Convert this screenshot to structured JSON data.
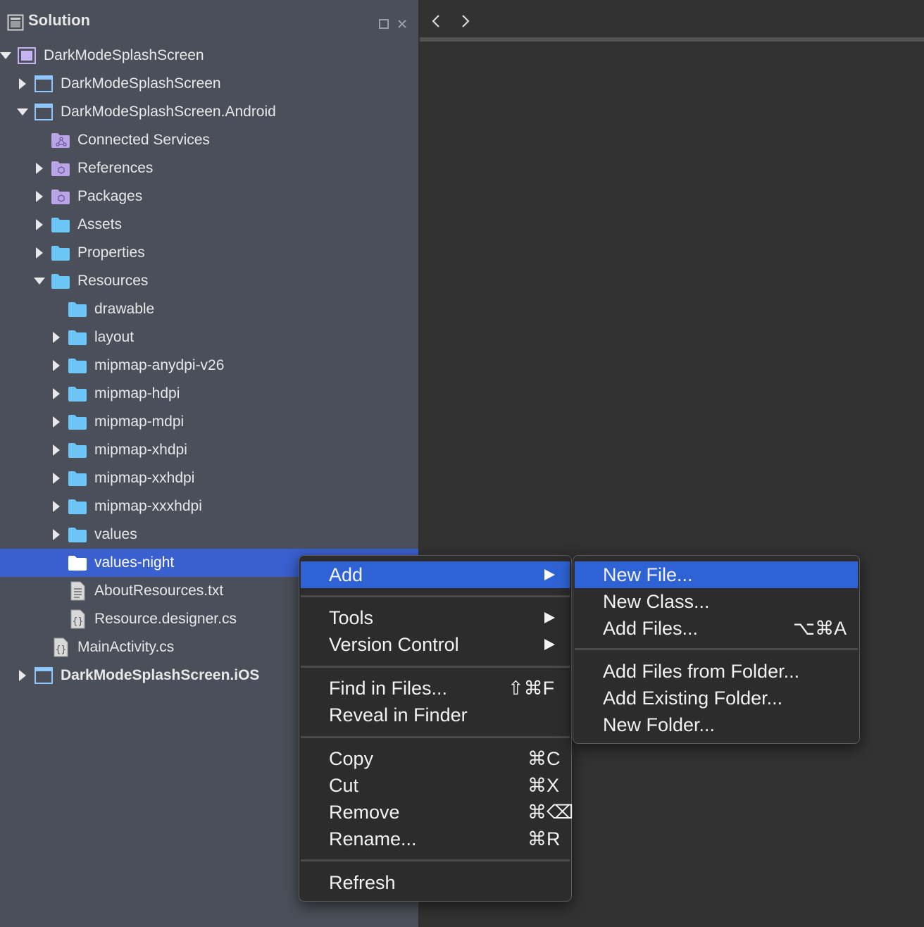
{
  "pane": {
    "title": "Solution"
  },
  "tree": [
    {
      "label": "DarkModeSplashScreen",
      "icon": "solution-icon",
      "toggle": "expanded",
      "bold": false
    },
    {
      "label": "DarkModeSplashScreen",
      "icon": "project-icon",
      "toggle": "collapsed",
      "bold": false
    },
    {
      "label": "DarkModeSplashScreen.Android",
      "icon": "project-icon",
      "toggle": "expanded",
      "bold": false
    },
    {
      "label": "Connected Services",
      "icon": "connected-services-folder-icon",
      "toggle": "none",
      "bold": false
    },
    {
      "label": "References",
      "icon": "references-folder-icon",
      "toggle": "collapsed",
      "bold": false
    },
    {
      "label": "Packages",
      "icon": "packages-folder-icon",
      "toggle": "collapsed",
      "bold": false
    },
    {
      "label": "Assets",
      "icon": "folder-icon",
      "toggle": "collapsed",
      "bold": false
    },
    {
      "label": "Properties",
      "icon": "folder-icon",
      "toggle": "collapsed",
      "bold": false
    },
    {
      "label": "Resources",
      "icon": "folder-icon",
      "toggle": "expanded",
      "bold": false
    },
    {
      "label": "drawable",
      "icon": "folder-icon",
      "toggle": "none",
      "bold": false
    },
    {
      "label": "layout",
      "icon": "folder-icon",
      "toggle": "collapsed",
      "bold": false
    },
    {
      "label": "mipmap-anydpi-v26",
      "icon": "folder-icon",
      "toggle": "collapsed",
      "bold": false
    },
    {
      "label": "mipmap-hdpi",
      "icon": "folder-icon",
      "toggle": "collapsed",
      "bold": false
    },
    {
      "label": "mipmap-mdpi",
      "icon": "folder-icon",
      "toggle": "collapsed",
      "bold": false
    },
    {
      "label": "mipmap-xhdpi",
      "icon": "folder-icon",
      "toggle": "collapsed",
      "bold": false
    },
    {
      "label": "mipmap-xxhdpi",
      "icon": "folder-icon",
      "toggle": "collapsed",
      "bold": false
    },
    {
      "label": "mipmap-xxxhdpi",
      "icon": "folder-icon",
      "toggle": "collapsed",
      "bold": false
    },
    {
      "label": "values",
      "icon": "folder-icon",
      "toggle": "collapsed",
      "bold": false
    },
    {
      "label": "values-night",
      "icon": "folder-icon",
      "toggle": "none",
      "bold": false,
      "selected": true
    },
    {
      "label": "AboutResources.txt",
      "icon": "text-file-icon",
      "toggle": "none",
      "bold": false
    },
    {
      "label": "Resource.designer.cs",
      "icon": "csharp-file-icon",
      "toggle": "none",
      "bold": false
    },
    {
      "label": "MainActivity.cs",
      "icon": "csharp-file-icon",
      "toggle": "none",
      "bold": false
    },
    {
      "label": "DarkModeSplashScreen.iOS",
      "icon": "project-icon",
      "toggle": "collapsed",
      "bold": true
    }
  ],
  "context_menu": {
    "add": "Add",
    "tools": "Tools",
    "version_control": "Version Control",
    "find_in_files": "Find in Files...",
    "find_in_files_shortcut": "⇧⌘F",
    "reveal_in_finder": "Reveal in Finder",
    "copy": "Copy",
    "copy_shortcut": "⌘C",
    "cut": "Cut",
    "cut_shortcut": "⌘X",
    "remove": "Remove",
    "remove_shortcut": "⌘⌫",
    "rename": "Rename...",
    "rename_shortcut": "⌘R",
    "refresh": "Refresh"
  },
  "add_submenu": {
    "new_file": "New File...",
    "new_class": "New Class...",
    "add_files": "Add Files...",
    "add_files_shortcut": "⌥⌘A",
    "add_files_from_folder": "Add Files from Folder...",
    "add_existing_folder": "Add Existing Folder...",
    "new_folder": "New Folder..."
  },
  "colors": {
    "sidebar_bg": "#4b4f59",
    "selection": "#3a5fcf",
    "menu_highlight": "#2f63d5",
    "folder": "#6cc6f5",
    "special_folder": "#b9a4e6"
  }
}
